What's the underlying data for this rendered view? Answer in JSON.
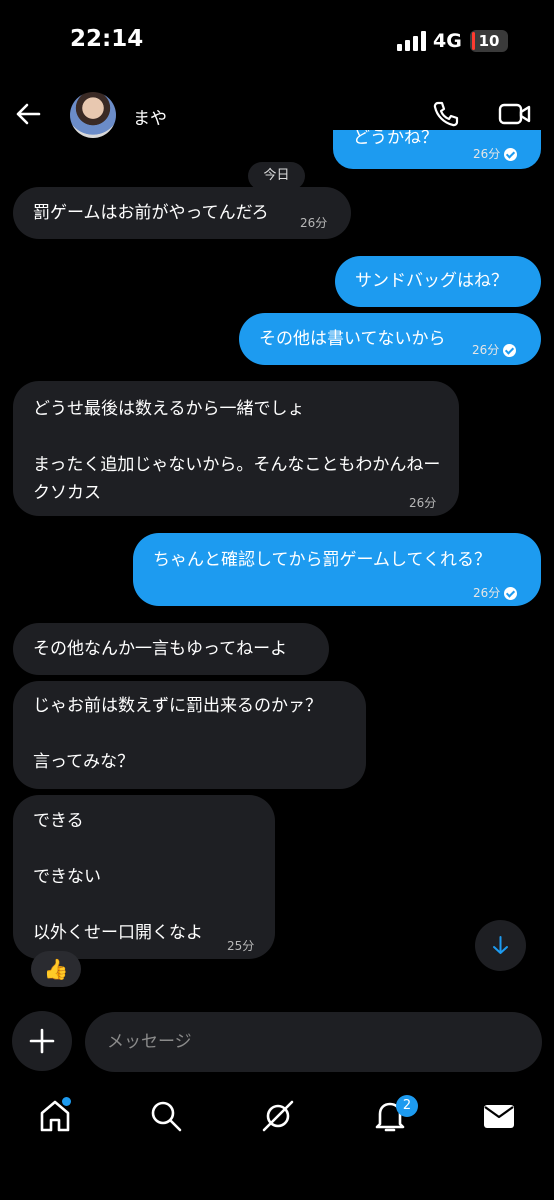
{
  "status_bar": {
    "time": "22:14",
    "network": "4G",
    "battery": "10",
    "battery_level": 0.1
  },
  "header": {
    "name": "まや"
  },
  "date_separator": "今日",
  "messages": [
    {
      "side": "out",
      "text": "どうかね？",
      "time": "26分",
      "read": true
    },
    {
      "side": "in",
      "text": "罰ゲームはお前がやってんだろ",
      "time": "26分"
    },
    {
      "side": "out",
      "text": "サンドバッグはね？",
      "time": ""
    },
    {
      "side": "out",
      "text": "その他は書いてないから",
      "time": "26分",
      "read": true
    },
    {
      "side": "in",
      "text": "どうせ最後は数えるから一緒でしょ\n\nまったく追加じゃないから。そんなこともわかんねークソカス",
      "time": "26分"
    },
    {
      "side": "out",
      "text": "ちゃんと確認してから罰ゲームしてくれる？",
      "time": "26分",
      "read": true
    },
    {
      "side": "in",
      "text": "その他なんか一言もゆってねーよ",
      "time": ""
    },
    {
      "side": "in",
      "text": "じゃお前は数えずに罰出来るのかァ？\n\n言ってみな？",
      "time": ""
    },
    {
      "side": "in",
      "text": "できる\n\nできない\n\n以外くせー口開くなよ",
      "time": "25分"
    }
  ],
  "reaction": "👍",
  "composer": {
    "placeholder": "メッセージ"
  },
  "nav": {
    "notifications_count": "2"
  },
  "colors": {
    "accent": "#1d9bf0",
    "bubble_in": "#1e1f23",
    "background": "#000000"
  }
}
